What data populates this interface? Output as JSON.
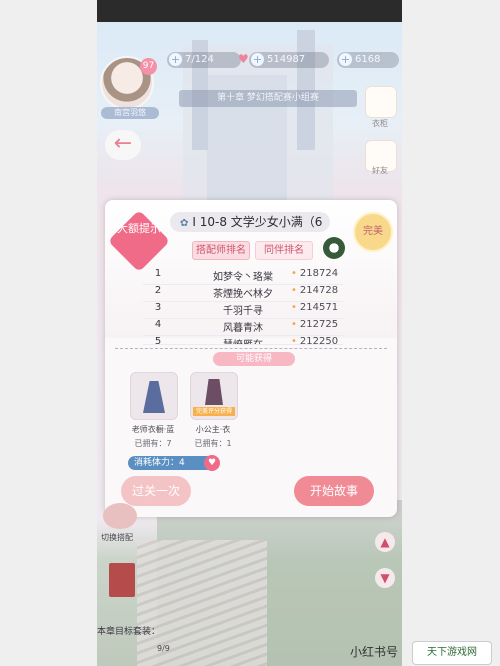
{
  "hud": {
    "energy": "7/124",
    "coins": "514987",
    "diamonds": "6168",
    "level": "97",
    "player_name": "南宫羽悠",
    "chapter": "第十章 梦幻搭配赛小组赛"
  },
  "side_menu": [
    {
      "label": "衣柜"
    },
    {
      "label": "好友"
    }
  ],
  "dialog": {
    "badge_left": "大额提示",
    "title": "I 10-8 文学少女小满（6",
    "badge_right": "完美",
    "tabs": [
      "搭配师排名",
      "同伴排名"
    ],
    "ranking": [
      {
        "rank": "1",
        "name": "如梦令丶珞棠",
        "score": "218724"
      },
      {
        "rank": "2",
        "name": "茶煙挽ベ林夕",
        "score": "214728"
      },
      {
        "rank": "3",
        "name": "千羽千寻",
        "score": "214571"
      },
      {
        "rank": "4",
        "name": "风暮青沐",
        "score": "212725"
      },
      {
        "rank": "5",
        "name": "慧燎雁在",
        "score": "212250"
      }
    ],
    "obtain_label": "可能获得",
    "items": [
      {
        "name": "老师衣橱·蓝",
        "owned": "已拥有：7",
        "tag": ""
      },
      {
        "name": "小公主·衣",
        "owned": "已拥有：1",
        "tag": "完美评分获得"
      }
    ],
    "stamina_label": "消耗体力：4",
    "buttons": {
      "skip": "过关一次",
      "start": "开始故事"
    }
  },
  "bottom": {
    "left_label": "切换搭配",
    "target_label": "本章目标套装：",
    "target_progress": "9/9"
  },
  "watermark": {
    "text": "小红书号",
    "logo_text": "天下游戏网"
  }
}
